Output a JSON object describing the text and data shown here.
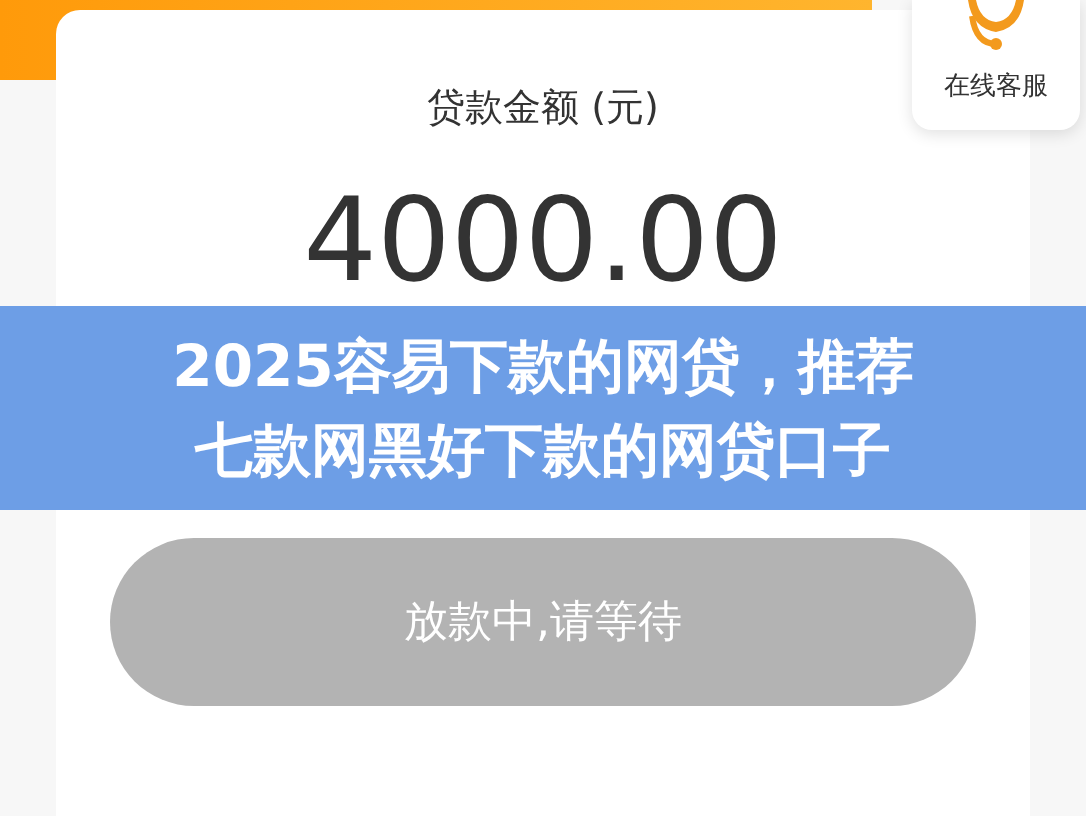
{
  "support": {
    "label": "在线客服"
  },
  "card": {
    "label": "贷款金额 (元)",
    "amount": "4000.00"
  },
  "banner": {
    "lines": [
      "2025容易下款的网贷，推荐",
      "七款网黑好下款的网贷口子"
    ]
  },
  "button": {
    "label": "放款中,请等待",
    "disabled": true
  }
}
